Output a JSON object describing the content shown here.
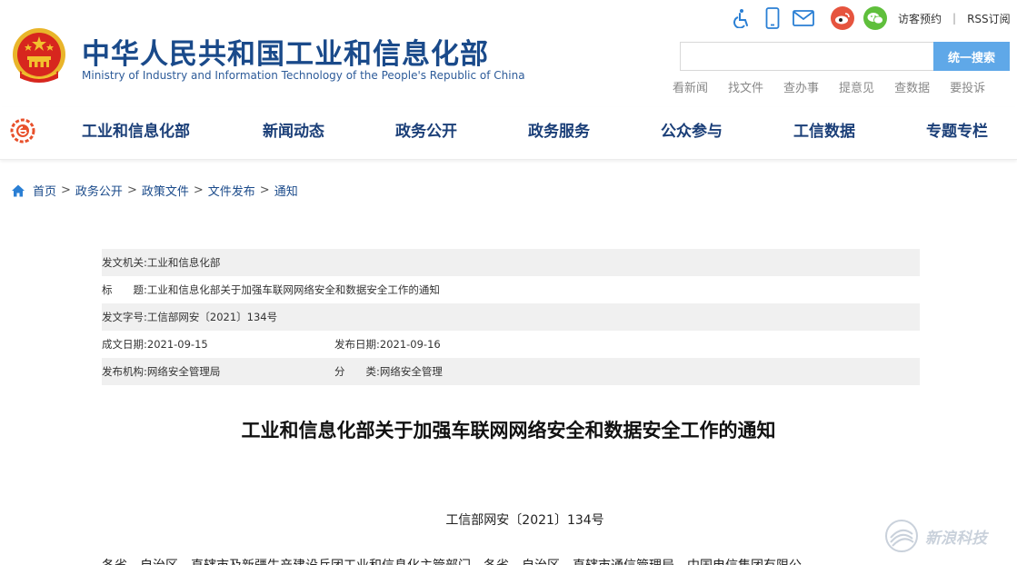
{
  "header": {
    "site_title": "中华人民共和国工业和信息化部",
    "site_subtitle": "Ministry of Industry and Information Technology of the People's Republic of China",
    "top_links": {
      "visitor": "访客预约",
      "separator": "|",
      "rss": "RSS订阅"
    },
    "search": {
      "value": "",
      "placeholder": "",
      "button_label": "统一搜索"
    },
    "quick_links": [
      "看新闻",
      "找文件",
      "查办事",
      "提意见",
      "查数据",
      "要投诉"
    ],
    "icons": [
      "accessibility-icon",
      "mobile-icon",
      "mail-icon",
      "weibo-icon",
      "wechat-icon"
    ]
  },
  "nav": {
    "items": [
      "工业和信息化部",
      "新闻动态",
      "政务公开",
      "政务服务",
      "公众参与",
      "工信数据",
      "专题专栏"
    ]
  },
  "breadcrumb": {
    "items": [
      "首页",
      "政务公开",
      "政策文件",
      "文件发布",
      "通知"
    ],
    "separator": ">"
  },
  "info": {
    "issuer_label": "发文机关:",
    "issuer_value": "工业和信息化部",
    "title_label": "标　　题:",
    "title_value": "工业和信息化部关于加强车联网网络安全和数据安全工作的通知",
    "doc_no_label": "发文字号:",
    "doc_no_value": "工信部网安〔2021〕134号",
    "created_label": "成文日期:",
    "created_value": "2021-09-15",
    "published_label": "发布日期:",
    "published_value": "2021-09-16",
    "org_label": "发布机构:",
    "org_value": "网络安全管理局",
    "category_label": "分　　类:",
    "category_value": "网络安全管理"
  },
  "document": {
    "title": "工业和信息化部关于加强车联网网络安全和数据安全工作的通知",
    "number": "工信部网安〔2021〕134号",
    "body_first_line": "各省、自治区、直辖市及新疆生产建设兵团工业和信息化主管部门，各省、自治区、直辖市通信管理局，中国电信集团有限公"
  },
  "watermark": {
    "text": "新浪科技"
  },
  "colors": {
    "brand_blue": "#1a4a8a",
    "search_button": "#5fa8e8",
    "nav_text": "#1b3f78",
    "emblem_red": "#d7261e",
    "emblem_gold": "#f2c12e"
  }
}
